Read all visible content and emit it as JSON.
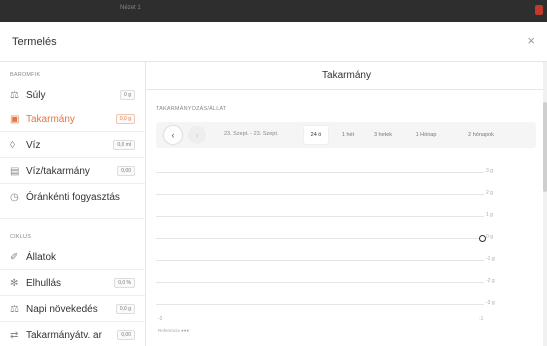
{
  "backdrop": {
    "window_title": "Nézet 1"
  },
  "modal": {
    "title": "Termelés",
    "close_symbol": "×"
  },
  "sidebar": {
    "sections": [
      {
        "label": "BAROMFIK",
        "items": [
          {
            "label": "Súly",
            "badge": "0 g",
            "icon": "scale-icon"
          },
          {
            "label": "Takarmány",
            "badge": "0,0 g",
            "icon": "feed-icon",
            "active": true
          },
          {
            "label": "Víz",
            "badge": "0,0 ml",
            "icon": "water-drop-icon"
          },
          {
            "label": "Víz/takarmány",
            "badge": "0,00",
            "icon": "ratio-icon"
          },
          {
            "label": "Óránkénti fogyasztás",
            "badge": "",
            "icon": "clock-icon"
          }
        ]
      },
      {
        "label": "CIKLUS",
        "items": [
          {
            "label": "Állatok",
            "badge": "",
            "icon": "bird-icon"
          },
          {
            "label": "Elhullás",
            "badge": "0,0 %",
            "icon": "mortality-icon"
          },
          {
            "label": "Napi növekedés",
            "badge": "0,0 g",
            "icon": "growth-icon"
          },
          {
            "label": "Takarmányátv. ar",
            "badge": "0,00",
            "icon": "conversion-icon"
          }
        ]
      }
    ]
  },
  "main": {
    "title": "Takarmány",
    "panel_label": "TAKARMÁNYOZÁS/ÁLLAT",
    "prev_symbol": "‹",
    "next_symbol": "›",
    "date_range": "23. Szept. - 23. Szept.",
    "range_tabs": [
      {
        "label": "24 ó",
        "active": true
      },
      {
        "label": "1 hét"
      },
      {
        "label": "3 hetek"
      },
      {
        "label": "1 Hónap"
      },
      {
        "label": "2 hónapok"
      }
    ]
  },
  "chart_data": {
    "type": "line",
    "y_ticks": [
      "3 g",
      "2 g",
      "1 g",
      "0 g",
      "-1 g",
      "-2 g",
      "-3 g"
    ],
    "x_labels": [
      "-2",
      "-1"
    ],
    "points": [
      {
        "x": -1,
        "y": 0
      }
    ],
    "ylim": [
      -3,
      3
    ],
    "footnote": "Referencia ●●●",
    "grid": true,
    "accent_color": "#e8743b"
  }
}
